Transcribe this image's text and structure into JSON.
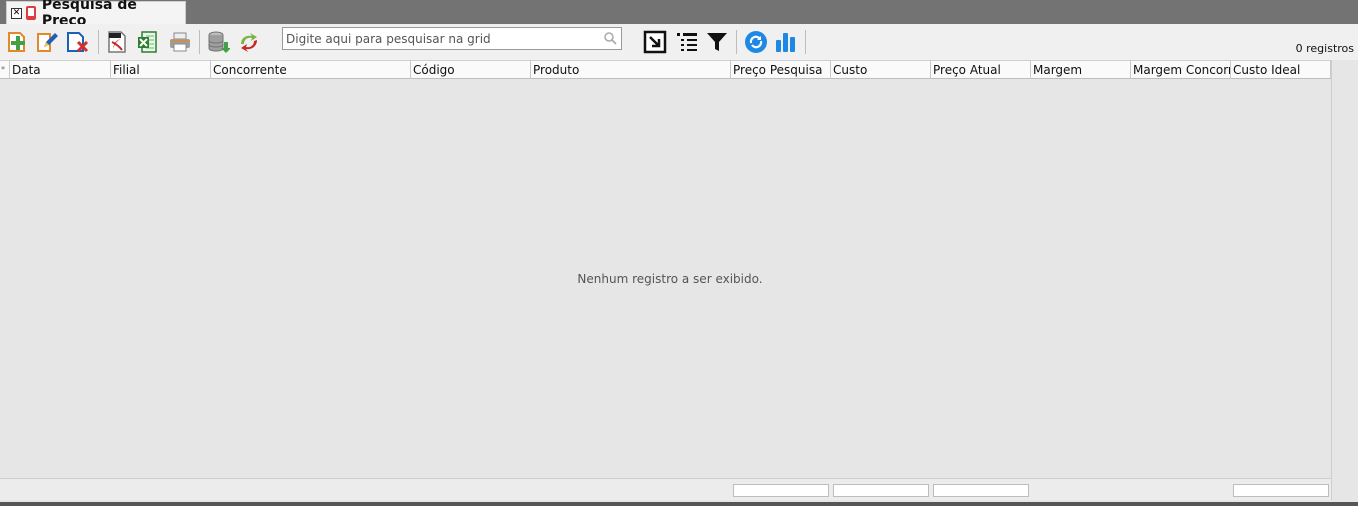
{
  "tab": {
    "title": "Pesquisa de Preco"
  },
  "toolbar": {
    "icons": [
      "add-document-icon",
      "edit-document-icon",
      "delete-document-icon",
      "pdf-export-icon",
      "excel-export-icon",
      "print-icon",
      "database-import-icon",
      "recycle-icon",
      "expand-icon",
      "list-columns-icon",
      "filter-icon",
      "refresh-icon",
      "chart-icon"
    ],
    "search_placeholder": "Digite aqui para pesquisar na grid",
    "registros": "0 registros"
  },
  "grid": {
    "columns": [
      "Data",
      "Filial",
      "Concorrente",
      "Código",
      "Produto",
      "Preço Pesquisa",
      "Custo",
      "Preço Atual",
      "Margem",
      "Margem Concorre",
      "Custo Ideal"
    ],
    "empty_message": "Nenhum registro a ser exibido."
  },
  "colors": {
    "tabstrip": "#737373",
    "accent_blue": "#1e88e5",
    "delete_red": "#d32f2f",
    "add_green": "#43a047"
  }
}
